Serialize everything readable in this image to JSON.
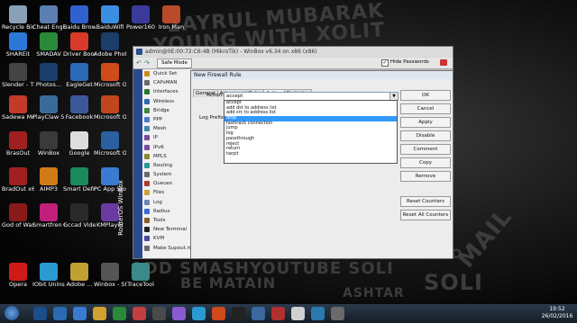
{
  "wallpaper": {
    "lines": [
      "2AYRUL MUBARAK",
      "YOUNG WITH XOLIT",
      "MAIL",
      "SOLI",
      "ADD SMASHYOUTUBE SOLI",
      "BE MATAIN",
      "TAINO",
      "ASHTAR"
    ]
  },
  "desktop_icons": [
    {
      "label": "Recycle Bin",
      "color": "#8aa0b8"
    },
    {
      "label": "Cheat Engine",
      "color": "#5b7fb0"
    },
    {
      "label": "Baidu Browser",
      "color": "#2f62d0"
    },
    {
      "label": "BaiduWifi",
      "color": "#3b8fe0"
    },
    {
      "label": "Power160",
      "color": "#3a3a9a"
    },
    {
      "label": "Iron Man",
      "color": "#b84a2a"
    },
    {
      "label": "SHAREit",
      "color": "#2b78d8"
    },
    {
      "label": "SMADAV",
      "color": "#2a8a3a"
    },
    {
      "label": "Driver Booster 3",
      "color": "#d83a2a"
    },
    {
      "label": "Adobe Photos...",
      "color": "#1b3d6a"
    },
    {
      "label": "Slender - The Ar...",
      "color": "#444"
    },
    {
      "label": "Photos...",
      "color": "#1b3d6a"
    },
    {
      "label": "EagleGet",
      "color": "#2a6ab8"
    },
    {
      "label": "Microsoft Office ...",
      "color": "#d04a1a"
    },
    {
      "label": "Sadewa Mo",
      "color": "#c23a2a"
    },
    {
      "label": "PlayClaw 5 Plus",
      "color": "#3a6a9a"
    },
    {
      "label": "Facebook",
      "color": "#3b5998"
    },
    {
      "label": "Microsoft Office P...",
      "color": "#c0461f"
    },
    {
      "label": "BrasOut",
      "color": "#a02020"
    },
    {
      "label": "WinBox",
      "color": "#3a3a3a"
    },
    {
      "label": "Google",
      "color": "#dddddd"
    },
    {
      "label": "Microsoft Office ...",
      "color": "#2a5fa0"
    },
    {
      "label": "BradOut x64",
      "color": "#a02020"
    },
    {
      "label": "AIMP3",
      "color": "#d07a1a"
    },
    {
      "label": "Smart Defrag 4",
      "color": "#1a8a5a"
    },
    {
      "label": "PC App Store",
      "color": "#3a7ad0"
    },
    {
      "label": "God of War II",
      "color": "#8a1a1a"
    },
    {
      "label": "Smartfren Connec...",
      "color": "#c0207a"
    },
    {
      "label": "Gccad Videos...",
      "color": "#2a2a2a"
    },
    {
      "label": "KMPlayer",
      "color": "#6a3aa0"
    },
    {
      "label": "Opera",
      "color": "#d01a1a"
    },
    {
      "label": "IObit Uninstal...",
      "color": "#2a9ad0"
    },
    {
      "label": "Adobe ...",
      "color": "#c0a030"
    },
    {
      "label": "Winbox - Shortcut",
      "color": "#555"
    },
    {
      "label": "TraceTool",
      "color": "#3a8a8a"
    }
  ],
  "winbox": {
    "title": "admin@0E:00:72:C6:4B (MikroTik) - WinBox v6.34 on x86 (x86)",
    "safe_mode": "Safe Mode",
    "hide_passwords": "Hide Passwords",
    "side_label": "RouterOS WinBox",
    "menu": [
      {
        "label": "Quick Set",
        "color": "#d08a1a"
      },
      {
        "label": "CAPsMAN",
        "color": "#6a6a6a"
      },
      {
        "label": "Interfaces",
        "color": "#2a7a2a"
      },
      {
        "label": "Wireless",
        "color": "#2a6ab0"
      },
      {
        "label": "Bridge",
        "color": "#3a8a3a"
      },
      {
        "label": "PPP",
        "color": "#4a7ad0"
      },
      {
        "label": "Mesh",
        "color": "#3a8ab0"
      },
      {
        "label": "IP",
        "color": "#7a4aa0"
      },
      {
        "label": "IPv6",
        "color": "#7a4aa0"
      },
      {
        "label": "MPLS",
        "color": "#8a8a2a"
      },
      {
        "label": "Routing",
        "color": "#2a9a9a"
      },
      {
        "label": "System",
        "color": "#6a6a6a"
      },
      {
        "label": "Queues",
        "color": "#b03a2a"
      },
      {
        "label": "Files",
        "color": "#d0a030"
      },
      {
        "label": "Log",
        "color": "#6a8ab0"
      },
      {
        "label": "Radius",
        "color": "#3a6ad0"
      },
      {
        "label": "Tools",
        "color": "#8a5a2a"
      },
      {
        "label": "New Terminal",
        "color": "#222"
      },
      {
        "label": "KVM",
        "color": "#4a4a9a"
      },
      {
        "label": "Make Supout.rif",
        "color": "#6a6a6a"
      }
    ]
  },
  "dialog": {
    "title": "New Firewall Rule",
    "tabs": [
      "General",
      "Advanced",
      "Extra",
      "Action",
      "Statistics"
    ],
    "active_tab": "Action",
    "action_label": "Action:",
    "action_value": "accept",
    "log_prefix_label": "Log Prefix:",
    "buttons": [
      "OK",
      "Cancel",
      "Apply",
      "Disable",
      "Comment",
      "Copy",
      "Remove",
      "Reset Counters",
      "Reset All Counters"
    ],
    "options": [
      "accept",
      "add dst to address list",
      "add src to address list",
      "drop",
      "fasttrack connection",
      "jump",
      "log",
      "passthrough",
      "reject",
      "return",
      "tarpit"
    ],
    "selected_option": "drop"
  },
  "taskbar": {
    "icons": [
      "#1c4e8a",
      "#2a6ab0",
      "#3a7ad0",
      "#d0a030",
      "#2a8a3a",
      "#c04040",
      "#4a4a4a",
      "#8a5ad0",
      "#2a9ad0",
      "#d04a1a",
      "#222",
      "#3a6aa0",
      "#b03030",
      "#d0d0d0",
      "#2a7ab0",
      "#6a6a6a"
    ],
    "time": "19:52",
    "date": "26/02/2016"
  }
}
